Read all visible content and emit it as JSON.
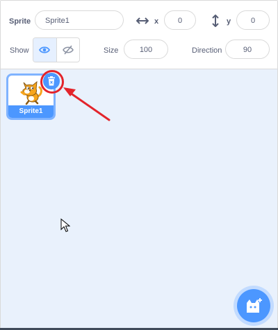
{
  "sprite_info": {
    "sprite_label": "Sprite",
    "sprite_name": "Sprite1",
    "x_label": "x",
    "x_value": "0",
    "y_label": "y",
    "y_value": "0",
    "show_label": "Show",
    "size_label": "Size",
    "size_value": "100",
    "direction_label": "Direction",
    "direction_value": "90"
  },
  "sprite_list": {
    "items": [
      {
        "name": "Sprite1",
        "selected": true
      }
    ]
  },
  "icons": {
    "x_axis": "horizontal-arrows-icon",
    "y_axis": "vertical-arrows-icon",
    "show": "eye-icon",
    "hide": "eye-slash-icon",
    "delete": "trash-icon",
    "choose_sprite": "cat-plus-icon"
  },
  "colors": {
    "accent": "#4c97ff",
    "annotation": "#e3242b",
    "pane_background": "#e9f1fc",
    "text": "#575e75"
  }
}
